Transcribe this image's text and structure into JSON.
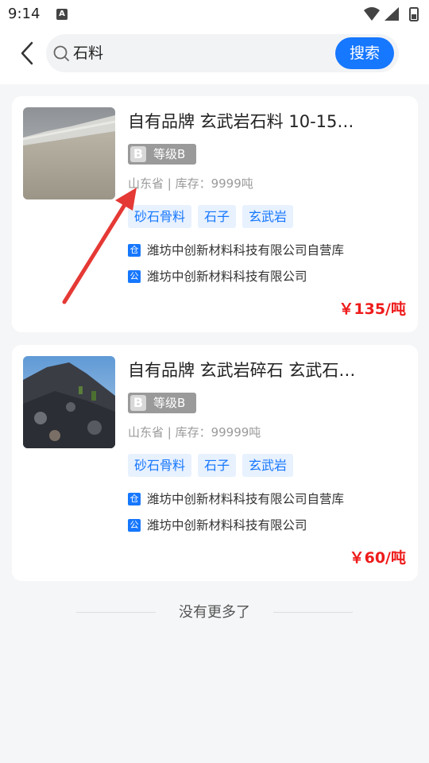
{
  "status_bar": {
    "time": "9:14",
    "notification_icon": "A"
  },
  "search": {
    "query": "石料",
    "button_label": "搜索"
  },
  "products": [
    {
      "title": "自有品牌 玄武岩石料 10-15…",
      "grade_letter": "B",
      "grade": "等级B",
      "meta": "山东省 | 库存：9999吨",
      "tags": [
        "砂石骨料",
        "石子",
        "玄武岩"
      ],
      "warehouse_icon": "仓",
      "warehouse": "潍坊中创新材料科技有限公司自营库",
      "company_icon": "公",
      "company": "潍坊中创新材料科技有限公司",
      "price": "￥135/吨"
    },
    {
      "title": "自有品牌 玄武岩碎石 玄武石…",
      "grade_letter": "B",
      "grade": "等级B",
      "meta": "山东省 | 库存：99999吨",
      "tags": [
        "砂石骨料",
        "石子",
        "玄武岩"
      ],
      "warehouse_icon": "仓",
      "warehouse": "潍坊中创新材料科技有限公司自营库",
      "company_icon": "公",
      "company": "潍坊中创新材料科技有限公司",
      "price": "￥60/吨"
    }
  ],
  "footer": {
    "no_more": "没有更多了"
  },
  "colors": {
    "accent": "#1677ff",
    "price": "#ee1b1b",
    "arrow": "#e53935"
  }
}
